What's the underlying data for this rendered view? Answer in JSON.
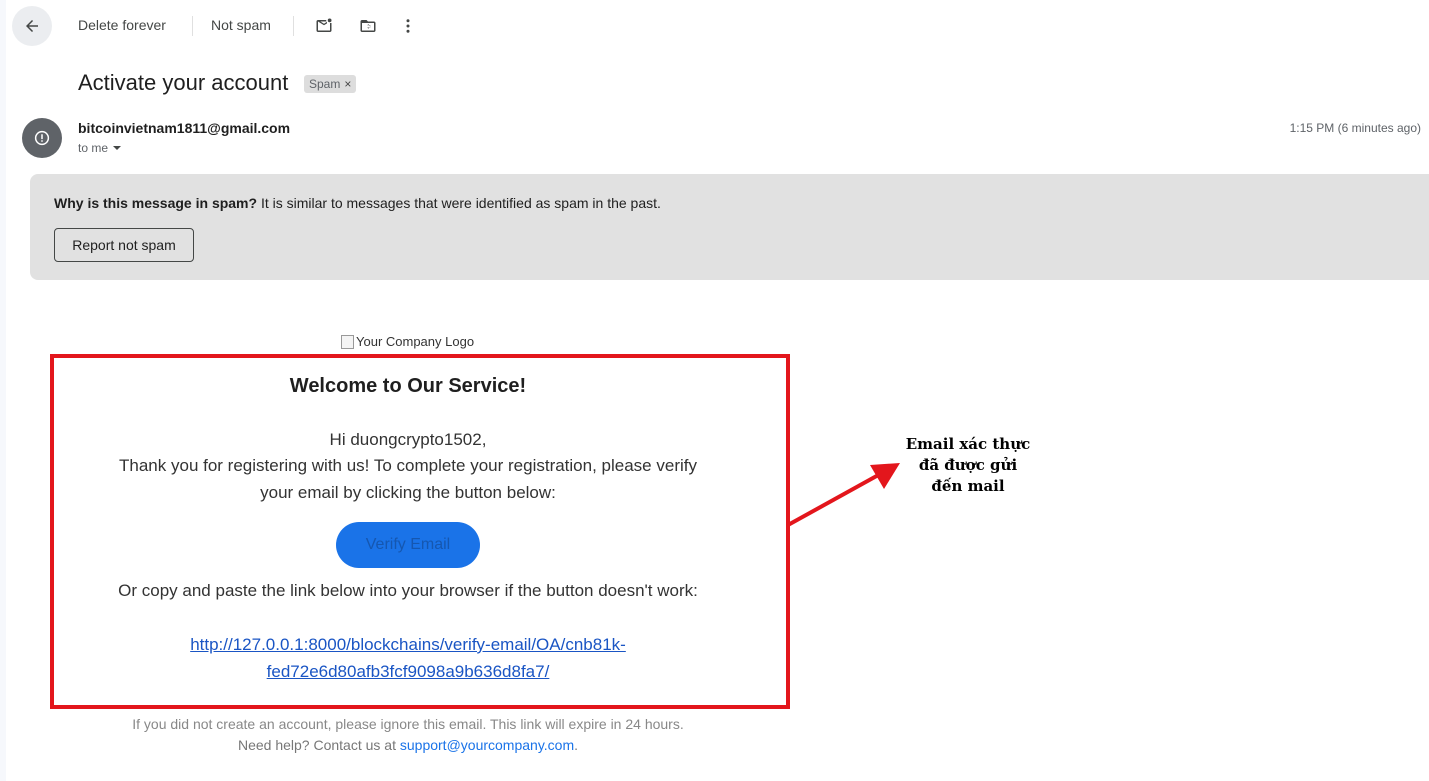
{
  "toolbar": {
    "back_icon": "arrow-left-icon",
    "delete_forever": "Delete forever",
    "not_spam": "Not spam",
    "mark_unread_icon": "mark-unread-icon",
    "move_to_icon": "move-to-folder-icon",
    "more_icon": "more-vert-icon"
  },
  "email": {
    "subject": "Activate your account",
    "label": "Spam",
    "label_remove": "×",
    "sender": "bitcoinvietnam1811@gmail.com",
    "to": "to me",
    "time": "1:15 PM (6 minutes ago)",
    "avatar_icon": "alert-circle-icon"
  },
  "spam_banner": {
    "question": "Why is this message in spam?",
    "reason": " It is similar to messages that were identified as spam in the past.",
    "report_button": "Report not spam"
  },
  "content": {
    "logo_alt": "Your Company Logo",
    "welcome": "Welcome to Our Service!",
    "greeting": "Hi duongcrypto1502,",
    "body": "Thank you for registering with us! To complete your registration, please verify your email by clicking the button below:",
    "button": "Verify Email",
    "alt_text": "Or copy and paste the link below into your browser if the button doesn't work:",
    "link": "http://127.0.0.1:8000/blockchains/verify-email/OA/cnb81k-fed72e6d80afb3fcf9098a9b636d8fa7/",
    "footer_line1": "If you did not create an account, please ignore this email. This link will expire in 24 hours.",
    "footer_help": "Need help? Contact us at ",
    "footer_email": "support@yourcompany.com",
    "footer_end": "."
  },
  "annotation": {
    "line1": "Email xác thực",
    "line2": "đã được gửi",
    "line3": "đến mail",
    "color": "#e3161c"
  }
}
